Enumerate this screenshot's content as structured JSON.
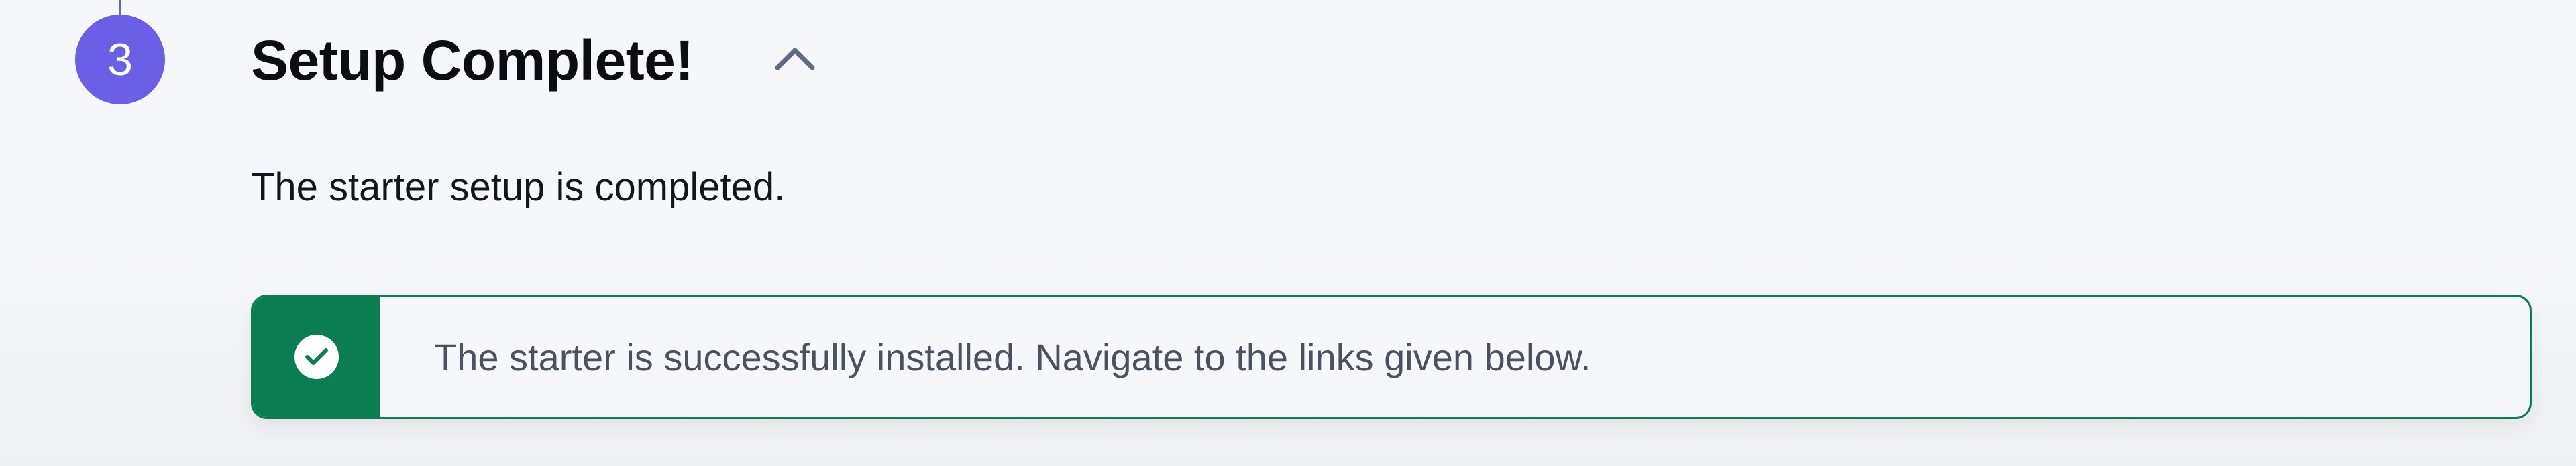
{
  "step": {
    "number": "3",
    "title": "Setup Complete!",
    "toggle_icon": "chevron-up-icon",
    "description": "The starter setup is completed."
  },
  "alert": {
    "status": "success",
    "icon": "check-circle-icon",
    "message": "The starter is successfully installed. Navigate to the links given below."
  },
  "colors": {
    "accent": "#6b60e5",
    "success": "#0b7d52",
    "background": "#f6f7fa",
    "title_text": "#0c0d12",
    "message_text": "#4a5262"
  }
}
